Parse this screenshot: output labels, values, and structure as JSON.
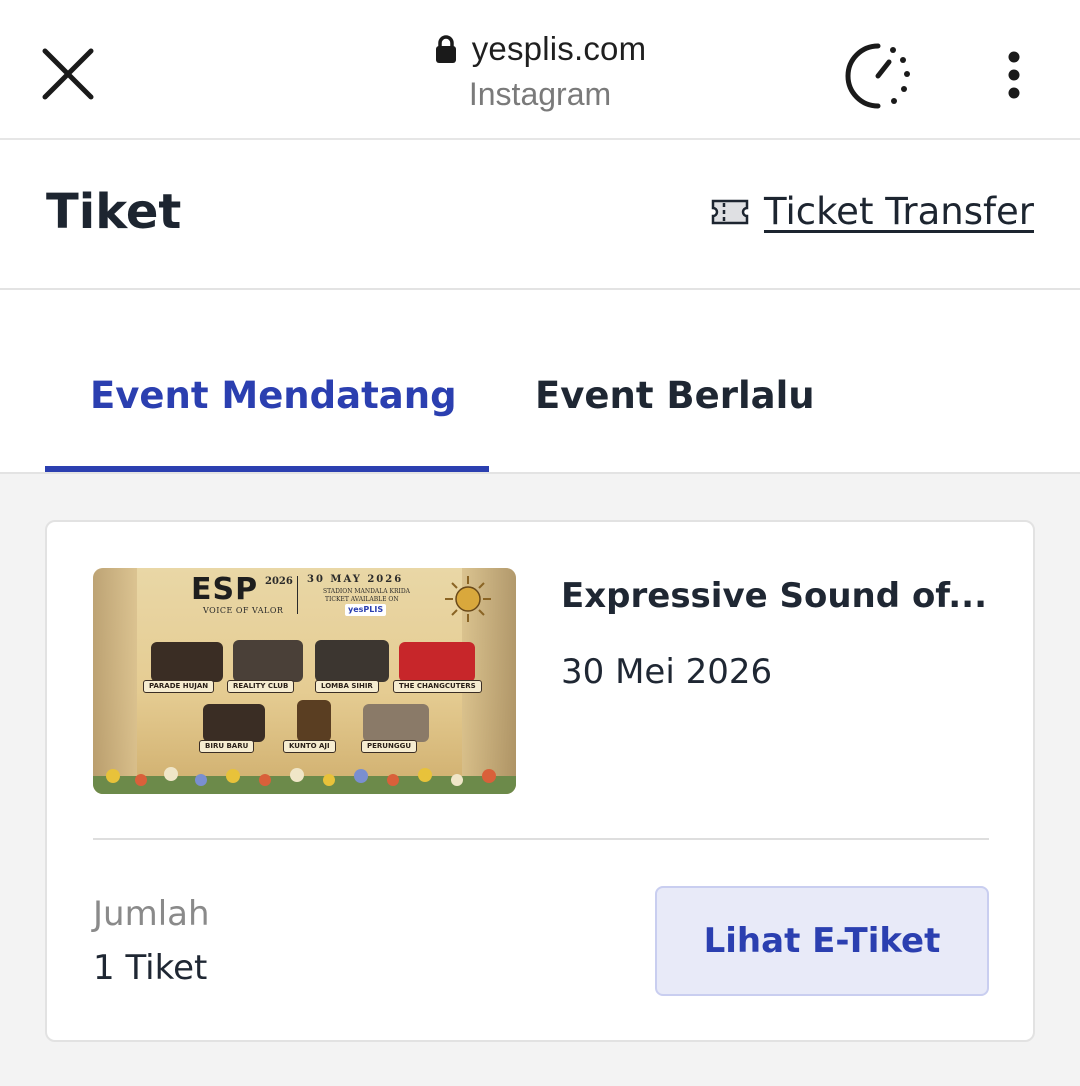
{
  "browser": {
    "url": "yesplis.com",
    "source": "Instagram",
    "icons": [
      "close-icon",
      "lock-icon",
      "timer-icon",
      "more-vertical-icon"
    ]
  },
  "header": {
    "title": "Tiket",
    "transfer_label": "Ticket Transfer",
    "transfer_icon": "ticket-icon"
  },
  "tabs": [
    {
      "label": "Event Mendatang",
      "active": true
    },
    {
      "label": "Event Berlalu",
      "active": false
    }
  ],
  "ticket": {
    "event_name": "Expressive Sound of...",
    "date": "30 Mei 2026",
    "quantity_label": "Jumlah",
    "quantity_value": "1 Tiket",
    "button_label": "Lihat E-Tiket",
    "poster": {
      "logo": "ESP",
      "logo_year": "2026",
      "tagline": "VOICE OF VALOR",
      "date_text": "30 MAY 2026",
      "venue": "STADION MANDALA KRIDA",
      "ticket_text": "TICKET AVAILABLE ON",
      "platform": "yesPLIS",
      "bands": [
        "PARADE HUJAN",
        "REALITY CLUB",
        "LOMBA SIHIR",
        "THE CHANGCUTERS",
        "BIRU BARU",
        "KUNTO AJI",
        "PERUNGGU"
      ]
    }
  },
  "colors": {
    "accent": "#2b3fb0",
    "button_bg": "#e8eaf8",
    "page_bg": "#f3f3f3"
  }
}
